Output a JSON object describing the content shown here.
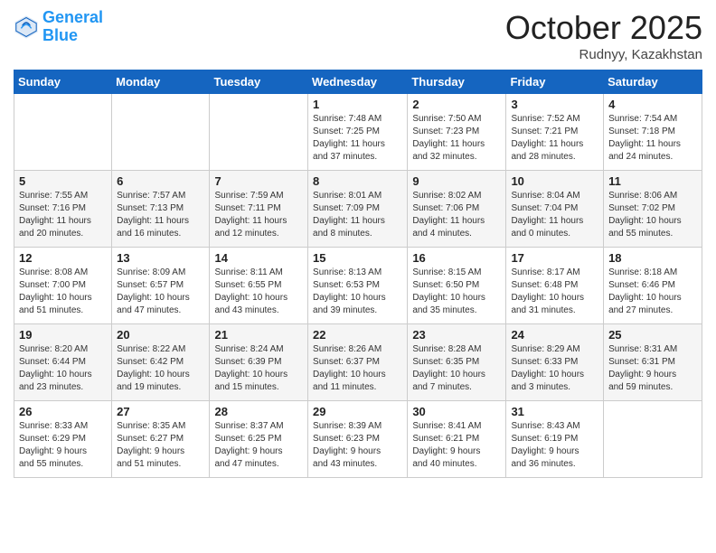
{
  "header": {
    "logo_general": "General",
    "logo_blue": "Blue",
    "title": "October 2025",
    "location": "Rudnyy, Kazakhstan"
  },
  "days_of_week": [
    "Sunday",
    "Monday",
    "Tuesday",
    "Wednesday",
    "Thursday",
    "Friday",
    "Saturday"
  ],
  "weeks": [
    [
      {
        "day": "",
        "info": ""
      },
      {
        "day": "",
        "info": ""
      },
      {
        "day": "",
        "info": ""
      },
      {
        "day": "1",
        "info": "Sunrise: 7:48 AM\nSunset: 7:25 PM\nDaylight: 11 hours\nand 37 minutes."
      },
      {
        "day": "2",
        "info": "Sunrise: 7:50 AM\nSunset: 7:23 PM\nDaylight: 11 hours\nand 32 minutes."
      },
      {
        "day": "3",
        "info": "Sunrise: 7:52 AM\nSunset: 7:21 PM\nDaylight: 11 hours\nand 28 minutes."
      },
      {
        "day": "4",
        "info": "Sunrise: 7:54 AM\nSunset: 7:18 PM\nDaylight: 11 hours\nand 24 minutes."
      }
    ],
    [
      {
        "day": "5",
        "info": "Sunrise: 7:55 AM\nSunset: 7:16 PM\nDaylight: 11 hours\nand 20 minutes."
      },
      {
        "day": "6",
        "info": "Sunrise: 7:57 AM\nSunset: 7:13 PM\nDaylight: 11 hours\nand 16 minutes."
      },
      {
        "day": "7",
        "info": "Sunrise: 7:59 AM\nSunset: 7:11 PM\nDaylight: 11 hours\nand 12 minutes."
      },
      {
        "day": "8",
        "info": "Sunrise: 8:01 AM\nSunset: 7:09 PM\nDaylight: 11 hours\nand 8 minutes."
      },
      {
        "day": "9",
        "info": "Sunrise: 8:02 AM\nSunset: 7:06 PM\nDaylight: 11 hours\nand 4 minutes."
      },
      {
        "day": "10",
        "info": "Sunrise: 8:04 AM\nSunset: 7:04 PM\nDaylight: 11 hours\nand 0 minutes."
      },
      {
        "day": "11",
        "info": "Sunrise: 8:06 AM\nSunset: 7:02 PM\nDaylight: 10 hours\nand 55 minutes."
      }
    ],
    [
      {
        "day": "12",
        "info": "Sunrise: 8:08 AM\nSunset: 7:00 PM\nDaylight: 10 hours\nand 51 minutes."
      },
      {
        "day": "13",
        "info": "Sunrise: 8:09 AM\nSunset: 6:57 PM\nDaylight: 10 hours\nand 47 minutes."
      },
      {
        "day": "14",
        "info": "Sunrise: 8:11 AM\nSunset: 6:55 PM\nDaylight: 10 hours\nand 43 minutes."
      },
      {
        "day": "15",
        "info": "Sunrise: 8:13 AM\nSunset: 6:53 PM\nDaylight: 10 hours\nand 39 minutes."
      },
      {
        "day": "16",
        "info": "Sunrise: 8:15 AM\nSunset: 6:50 PM\nDaylight: 10 hours\nand 35 minutes."
      },
      {
        "day": "17",
        "info": "Sunrise: 8:17 AM\nSunset: 6:48 PM\nDaylight: 10 hours\nand 31 minutes."
      },
      {
        "day": "18",
        "info": "Sunrise: 8:18 AM\nSunset: 6:46 PM\nDaylight: 10 hours\nand 27 minutes."
      }
    ],
    [
      {
        "day": "19",
        "info": "Sunrise: 8:20 AM\nSunset: 6:44 PM\nDaylight: 10 hours\nand 23 minutes."
      },
      {
        "day": "20",
        "info": "Sunrise: 8:22 AM\nSunset: 6:42 PM\nDaylight: 10 hours\nand 19 minutes."
      },
      {
        "day": "21",
        "info": "Sunrise: 8:24 AM\nSunset: 6:39 PM\nDaylight: 10 hours\nand 15 minutes."
      },
      {
        "day": "22",
        "info": "Sunrise: 8:26 AM\nSunset: 6:37 PM\nDaylight: 10 hours\nand 11 minutes."
      },
      {
        "day": "23",
        "info": "Sunrise: 8:28 AM\nSunset: 6:35 PM\nDaylight: 10 hours\nand 7 minutes."
      },
      {
        "day": "24",
        "info": "Sunrise: 8:29 AM\nSunset: 6:33 PM\nDaylight: 10 hours\nand 3 minutes."
      },
      {
        "day": "25",
        "info": "Sunrise: 8:31 AM\nSunset: 6:31 PM\nDaylight: 9 hours\nand 59 minutes."
      }
    ],
    [
      {
        "day": "26",
        "info": "Sunrise: 8:33 AM\nSunset: 6:29 PM\nDaylight: 9 hours\nand 55 minutes."
      },
      {
        "day": "27",
        "info": "Sunrise: 8:35 AM\nSunset: 6:27 PM\nDaylight: 9 hours\nand 51 minutes."
      },
      {
        "day": "28",
        "info": "Sunrise: 8:37 AM\nSunset: 6:25 PM\nDaylight: 9 hours\nand 47 minutes."
      },
      {
        "day": "29",
        "info": "Sunrise: 8:39 AM\nSunset: 6:23 PM\nDaylight: 9 hours\nand 43 minutes."
      },
      {
        "day": "30",
        "info": "Sunrise: 8:41 AM\nSunset: 6:21 PM\nDaylight: 9 hours\nand 40 minutes."
      },
      {
        "day": "31",
        "info": "Sunrise: 8:43 AM\nSunset: 6:19 PM\nDaylight: 9 hours\nand 36 minutes."
      },
      {
        "day": "",
        "info": ""
      }
    ]
  ]
}
